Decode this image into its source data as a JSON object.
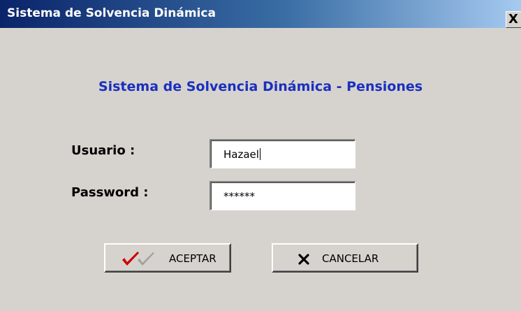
{
  "window": {
    "title": "Sistema de Solvencia Dinámica",
    "close_glyph": "X"
  },
  "heading": "Sistema de Solvencia Dinámica - Pensiones",
  "form": {
    "user_label": "Usuario :",
    "user_value": "Hazael",
    "password_label": "Password  :",
    "password_value": "******"
  },
  "buttons": {
    "accept_label": "ACEPTAR",
    "accept_icon": "double-checkmark-icon",
    "cancel_label": "CANCELAR",
    "cancel_icon": "x-icon"
  },
  "colors": {
    "heading": "#1a2fc0",
    "checkmark": "#cc0000",
    "checkmark_secondary": "#a0a0a0"
  }
}
